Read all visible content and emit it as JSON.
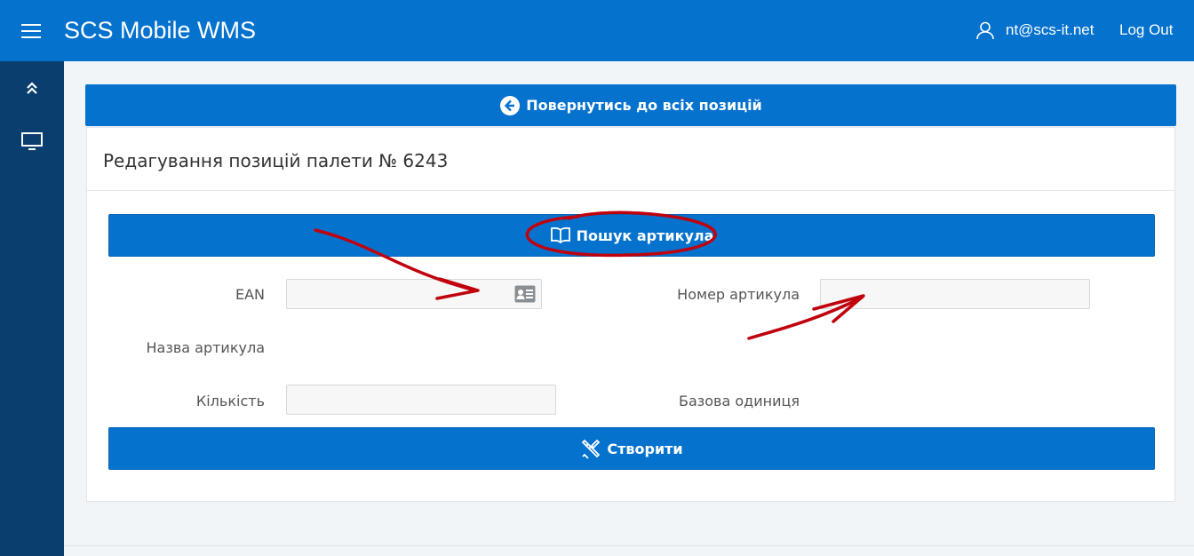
{
  "header": {
    "app_title": "SCS Mobile WMS",
    "user_email": "nt@scs-it.net",
    "logout_label": "Log Out"
  },
  "back_button": {
    "label": "Повернутись до всіх позицій"
  },
  "card": {
    "title": "Редагування позицій палети № 6243"
  },
  "search_button": {
    "label": "Пошук артикула"
  },
  "fields": {
    "ean": {
      "label": "EAN",
      "value": ""
    },
    "article_number": {
      "label": "Номер артикула",
      "value": ""
    },
    "article_name": {
      "label": "Назва артикула"
    },
    "quantity": {
      "label": "Кількість",
      "value": ""
    },
    "base_unit": {
      "label": "Базова одиниця"
    }
  },
  "create_button": {
    "label": "Створити"
  },
  "colors": {
    "primary": "#0572ce",
    "sidebar": "#0a3e6f",
    "annotation": "#c0000d"
  },
  "icons": {
    "menu": "hamburger-icon",
    "user": "user-icon",
    "collapse": "double-chevron-up-icon",
    "monitor": "monitor-icon",
    "back": "arrow-left-circle-icon",
    "book": "book-open-icon",
    "scan": "id-card-icon",
    "create": "pencil-ruler-icon"
  }
}
